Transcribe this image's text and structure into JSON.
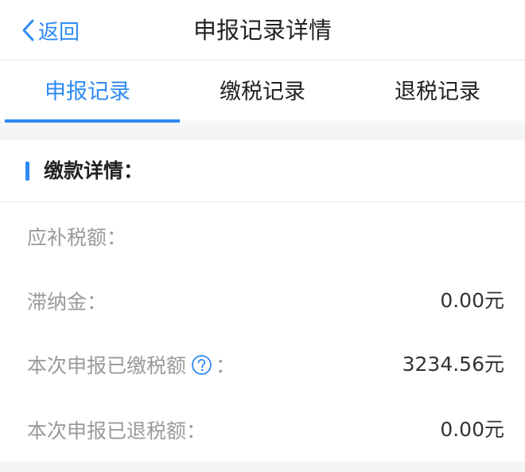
{
  "header": {
    "back_label": "返回",
    "title": "申报记录详情"
  },
  "tabs": [
    {
      "label": "申报记录",
      "active": true
    },
    {
      "label": "缴税记录",
      "active": false
    },
    {
      "label": "退税记录",
      "active": false
    }
  ],
  "section": {
    "title": "缴款详情："
  },
  "rows": [
    {
      "label": "应补税额：",
      "value": ""
    },
    {
      "label": "滞纳金：",
      "value": "0.00元"
    },
    {
      "label": "本次申报已缴税额",
      "label_suffix": "：",
      "value": "3234.56元"
    },
    {
      "label": "本次申报已退税额：",
      "value": "0.00元"
    }
  ],
  "colors": {
    "accent": "#2f8af5",
    "label_gray": "#9a9a9a",
    "divider": "#ececec",
    "band": "#f4f5f7"
  },
  "icons": {
    "back": "chevron-left-icon",
    "help": "question-circle-icon"
  }
}
